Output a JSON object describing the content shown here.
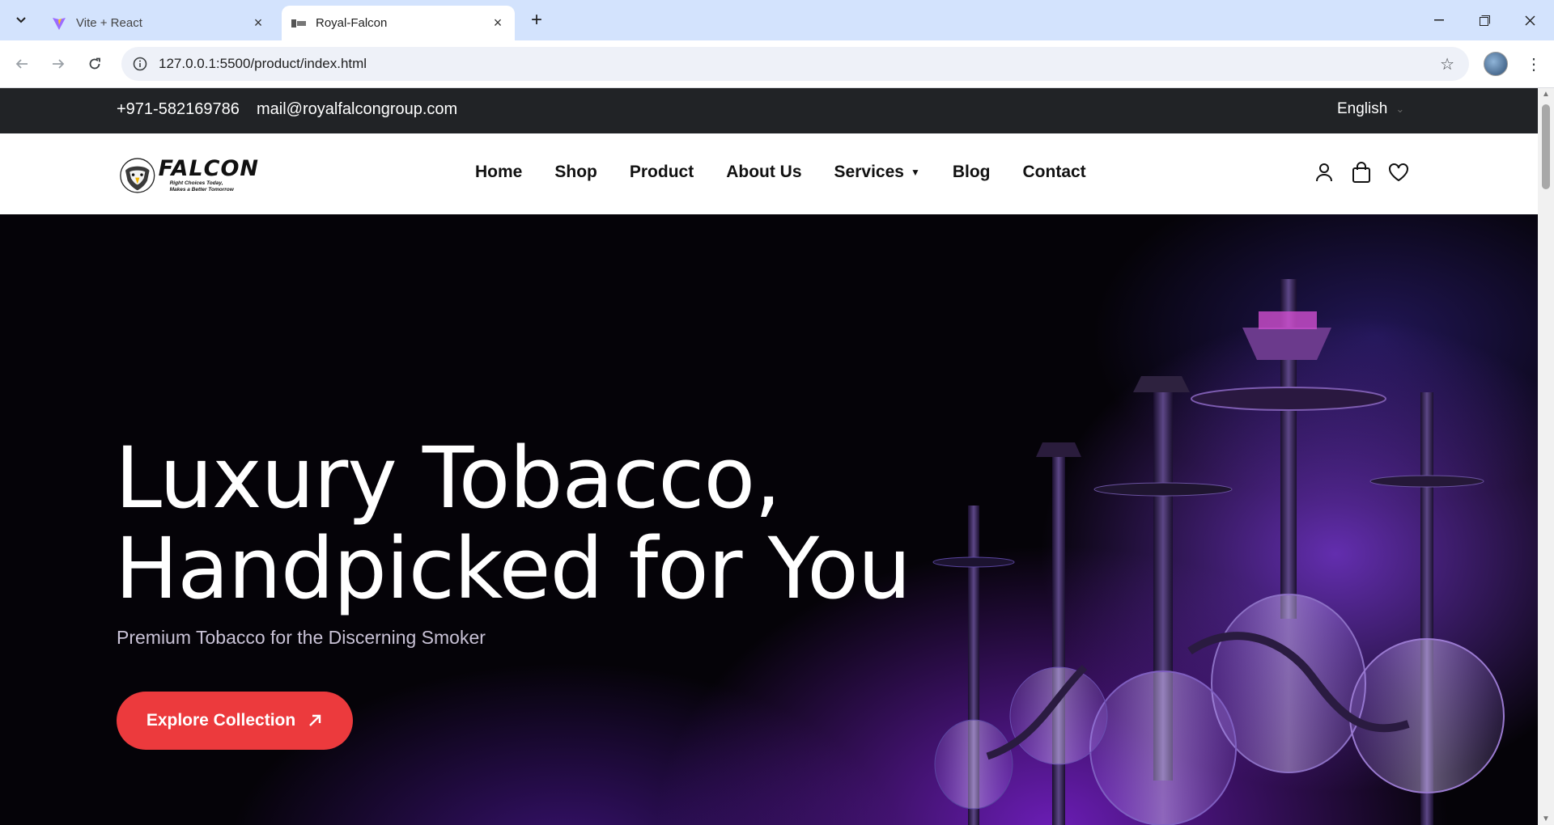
{
  "browser": {
    "tabs": [
      {
        "title": "Vite + React",
        "favicon": "vite-logo-icon",
        "active": false
      },
      {
        "title": "Royal-Falcon",
        "favicon": "falcon-favicon-icon",
        "active": true
      }
    ],
    "url": "127.0.0.1:5500/product/index.html",
    "icons": {
      "tab_search": "chevron-down-icon",
      "new_tab": "plus-icon",
      "back": "arrow-left-icon",
      "forward": "arrow-right-icon",
      "reload": "reload-icon",
      "site_info": "info-icon",
      "bookmark": "star-icon",
      "profile": "avatar",
      "menu": "kebab-menu-icon",
      "minimize": "minimize-icon",
      "restore": "restore-icon",
      "close": "close-icon"
    }
  },
  "topbar": {
    "phone": "+971-582169786",
    "email": "mail@royalfalcongroup.com",
    "language": "English"
  },
  "header": {
    "logo": {
      "word": "FALCON",
      "tagline_1": "Right Choices Today,",
      "tagline_2": "Makes a Better Tomorrow"
    },
    "nav": [
      {
        "label": "Home"
      },
      {
        "label": "Shop"
      },
      {
        "label": "Product"
      },
      {
        "label": "About Us"
      },
      {
        "label": "Services",
        "has_dropdown": true
      },
      {
        "label": "Blog"
      },
      {
        "label": "Contact"
      }
    ],
    "icons": [
      "user-icon",
      "shopping-bag-icon",
      "heart-icon"
    ]
  },
  "hero": {
    "title_line1": "Luxury Tobacco,",
    "title_line2": "Handpicked for You",
    "subtitle": "Premium Tobacco for the Discerning Smoker",
    "cta_label": "Explore Collection",
    "cta_color": "#ec3a3d",
    "background_color": "#050308",
    "accent_color": "#8a3cff"
  }
}
